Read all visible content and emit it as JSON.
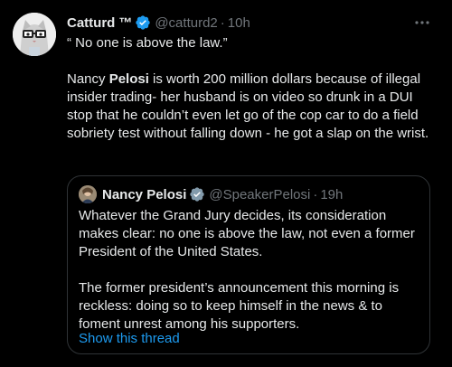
{
  "author": {
    "display_name": "Catturd",
    "badge": "™",
    "handle": "@catturd2",
    "separator": "·",
    "time": "10h",
    "verified_color": "#1d9bf0"
  },
  "body": {
    "paragraph1": "“ No one is above the law.”",
    "paragraph2_part1": "Nancy ",
    "paragraph2_bold": "Pelosi",
    "paragraph2_part2": " is worth 200 million dollars because of illegal insider trading- her husband is on video so drunk in a DUI stop that he couldn’t even let go of the cop car to do a field sobriety test without falling down - he got a slap on the wrist."
  },
  "quoted": {
    "display_name": "Nancy Pelosi",
    "handle": "@SpeakerPelosi",
    "separator": "·",
    "time": "19h",
    "paragraph1": "Whatever the Grand Jury decides, its consideration makes clear: no one is above the law, not even a former President of the United States.",
    "paragraph2": "The former president’s announcement this morning is reckless: doing so to keep himself in the news & to foment unrest among his supporters.",
    "show_thread": "Show this thread"
  },
  "icons": {
    "more": "more-options-icon",
    "verified": "verified-badge-icon"
  },
  "colors": {
    "background": "#000000",
    "text": "#e7e9ea",
    "muted": "#71767b",
    "link": "#1d9bf0",
    "border": "#2f3336"
  }
}
